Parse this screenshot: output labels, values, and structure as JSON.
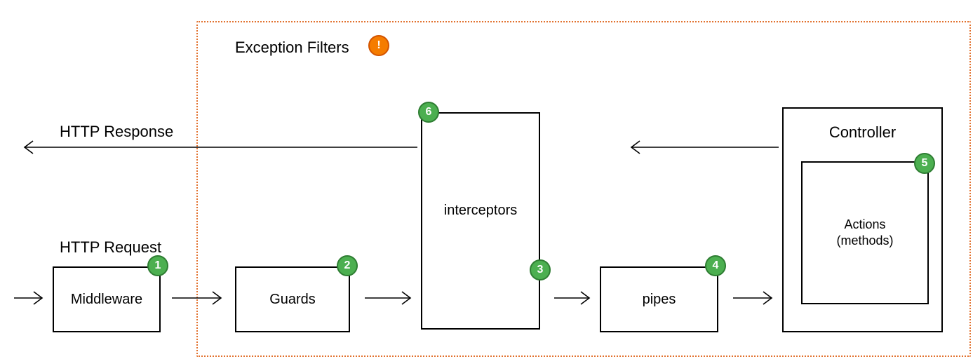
{
  "labels": {
    "exception_filters": "Exception Filters",
    "http_response": "HTTP Response",
    "http_request": "HTTP Request"
  },
  "badges": {
    "alert": "!",
    "b1": "1",
    "b2": "2",
    "b3": "3",
    "b4": "4",
    "b5": "5",
    "b6": "6"
  },
  "boxes": {
    "middleware": "Middleware",
    "guards": "Guards",
    "interceptors": "interceptors",
    "pipes": "pipes",
    "controller": "Controller",
    "actions": "Actions\n(methods)"
  }
}
